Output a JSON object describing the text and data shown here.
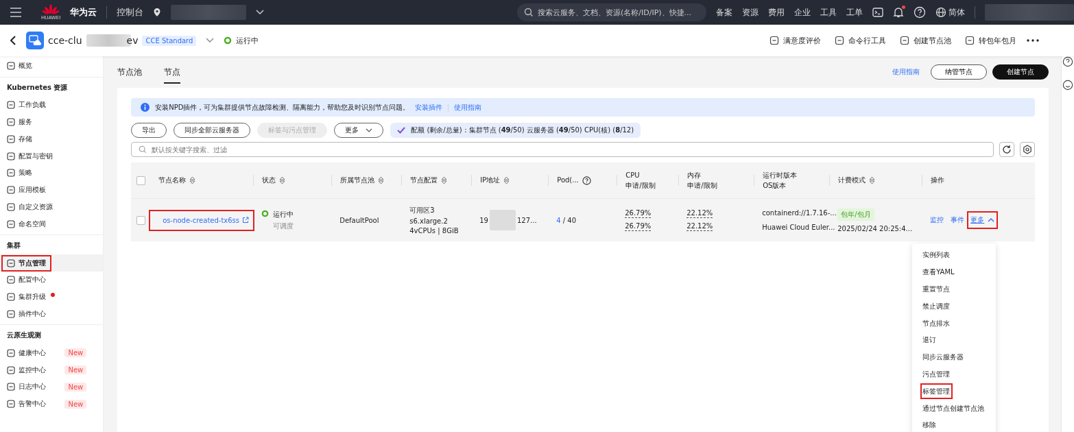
{
  "topbar": {
    "brand": "华为云",
    "logo_caption": "HUAWEI",
    "console": "控制台",
    "search_placeholder": "搜索云服务、文档、资源(名称/ID/IP)、快捷...",
    "nav": [
      "备案",
      "资源",
      "费用",
      "企业",
      "工具",
      "工单"
    ],
    "language": "简体",
    "notification_dot": true
  },
  "header": {
    "cluster_prefix": "cce-clu",
    "cluster_suffix": "ev",
    "edition": "CCE Standard",
    "status": "运行中",
    "actions": [
      "满意度评价",
      "命令行工具",
      "创建节点池",
      "转包年包月"
    ]
  },
  "sidebar": {
    "sections": [
      {
        "items": [
          {
            "label": "概览",
            "selected": false,
            "highlighted": false,
            "dot": false
          }
        ]
      },
      {
        "title": "Kubernetes 资源",
        "items": [
          {
            "label": "工作负载",
            "selected": false,
            "highlighted": false,
            "dot": false
          },
          {
            "label": "服务",
            "selected": false,
            "highlighted": false,
            "dot": false
          },
          {
            "label": "存储",
            "selected": false,
            "highlighted": false,
            "dot": false
          },
          {
            "label": "配置与密钥",
            "selected": false,
            "highlighted": false,
            "dot": false
          },
          {
            "label": "策略",
            "selected": false,
            "highlighted": false,
            "dot": false
          },
          {
            "label": "应用模板",
            "selected": false,
            "highlighted": false,
            "dot": false
          },
          {
            "label": "自定义资源",
            "selected": false,
            "highlighted": false,
            "dot": false
          },
          {
            "label": "命名空间",
            "selected": false,
            "highlighted": false,
            "dot": false
          }
        ]
      },
      {
        "title": "集群",
        "items": [
          {
            "label": "节点管理",
            "selected": true,
            "highlighted": true,
            "dot": false
          },
          {
            "label": "配置中心",
            "selected": false,
            "highlighted": false,
            "dot": false
          },
          {
            "label": "集群升级",
            "selected": false,
            "highlighted": false,
            "dot": true
          },
          {
            "label": "插件中心",
            "selected": false,
            "highlighted": false,
            "dot": false
          }
        ]
      },
      {
        "title": "云原生观测",
        "items": [
          {
            "label": "健康中心",
            "selected": false,
            "highlighted": false,
            "dot": false,
            "badge": "New"
          },
          {
            "label": "监控中心",
            "selected": false,
            "highlighted": false,
            "dot": false,
            "badge": "New"
          },
          {
            "label": "日志中心",
            "selected": false,
            "highlighted": false,
            "dot": false,
            "badge": "New"
          },
          {
            "label": "告警中心",
            "selected": false,
            "highlighted": false,
            "dot": false,
            "badge": "New"
          }
        ]
      }
    ]
  },
  "tabs": [
    {
      "label": "节点池",
      "selected": false
    },
    {
      "label": "节点",
      "selected": true
    }
  ],
  "page_actions": {
    "guide_link": "使用指南",
    "buttons": [
      {
        "label": "纳管节点",
        "primary": false
      },
      {
        "label": "创建节点",
        "primary": true
      }
    ]
  },
  "notice": {
    "text": "安装NPD插件，可为集群提供节点故障检测、隔离能力，帮助您及时识别节点问题。",
    "links": [
      "安装插件",
      "使用指南"
    ]
  },
  "toolbar": {
    "buttons": [
      {
        "label": "导出",
        "disabled": false,
        "caret": false
      },
      {
        "label": "同步全部云服务器",
        "disabled": false,
        "caret": false
      },
      {
        "label": "标签与污点管理",
        "disabled": true,
        "caret": false
      },
      {
        "label": "更多",
        "disabled": false,
        "caret": true
      }
    ],
    "quota": "配额 (剩余/总量)：集群节点 (**49**/50) 云服务器 (**49**/50) CPU(核) (**8**/12)"
  },
  "filter": {
    "placeholder": "默认按关键字搜索、过滤"
  },
  "table": {
    "all_checked": false,
    "columns": [
      {
        "lines": [
          "节点名称"
        ],
        "sortable": true,
        "help": false
      },
      {
        "lines": [
          "状态"
        ],
        "sortable": true,
        "help": false
      },
      {
        "lines": [
          "所属节点池"
        ],
        "sortable": true,
        "help": false
      },
      {
        "lines": [
          "节点配置"
        ],
        "sortable": true,
        "help": false
      },
      {
        "lines": [
          "IP地址"
        ],
        "sortable": true,
        "help": false
      },
      {
        "lines": [
          "Pod(..."
        ],
        "sortable": false,
        "help": true
      },
      {
        "lines": [
          "CPU",
          "申请/限制"
        ],
        "sortable": false,
        "help": false
      },
      {
        "lines": [
          "内存",
          "申请/限制"
        ],
        "sortable": false,
        "help": false
      },
      {
        "lines": [
          "运行时版本",
          "OS版本"
        ],
        "sortable": false,
        "help": false
      },
      {
        "lines": [
          "计费模式"
        ],
        "sortable": true,
        "help": false
      },
      {
        "lines": [
          "操作"
        ],
        "sortable": false,
        "help": false
      }
    ],
    "rows": [
      {
        "checked": false,
        "name": "os-node-created-tx6ss",
        "name_highlighted": true,
        "status": "运行中",
        "schedulable": "可调度",
        "pool": "DefaultPool",
        "config": [
          "可用区3",
          "s6.xlarge.2",
          "4vCPUs | 8GiB"
        ],
        "ip_prefix": "19",
        "ip_suffix": "127...",
        "pods_used": "4",
        "pods_total": "/ 40",
        "cpu": [
          "26.79%",
          "26.79%"
        ],
        "memory": [
          "22.12%",
          "22.12%"
        ],
        "runtime": "containerd://1.7.16-...",
        "os": "Huawei Cloud Euler...",
        "billing_tag": "包年/包月",
        "billing_time": "2025/02/24 20:25:4...",
        "ops": [
          "监控",
          "事件"
        ],
        "more": "更多",
        "more_highlighted": true,
        "more_expanded": true
      }
    ]
  },
  "more_menu": [
    {
      "label": "实例列表",
      "highlighted": false
    },
    {
      "label": "查看YAML",
      "highlighted": false
    },
    {
      "label": "重置节点",
      "highlighted": false
    },
    {
      "label": "禁止调度",
      "highlighted": false
    },
    {
      "label": "节点排水",
      "highlighted": false
    },
    {
      "label": "退订",
      "highlighted": false
    },
    {
      "label": "同步云服务器",
      "highlighted": false
    },
    {
      "label": "污点管理",
      "highlighted": false
    },
    {
      "label": "标签管理",
      "highlighted": true
    },
    {
      "label": "通过节点创建节点池",
      "highlighted": false
    },
    {
      "label": "移除",
      "highlighted": false
    }
  ]
}
